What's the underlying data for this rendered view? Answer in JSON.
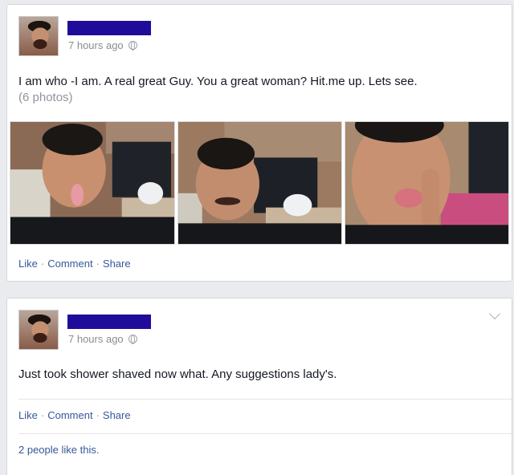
{
  "posts": [
    {
      "timestamp": "7 hours ago",
      "text": "I am who -I am. A real great Guy. You a great woman? Hit.me up. Lets see.",
      "photo_count": "(6 photos)",
      "actions": {
        "like": "Like",
        "comment": "Comment",
        "share": "Share",
        "separator": "·"
      }
    },
    {
      "timestamp": "7 hours ago",
      "text": "Just took shower shaved now what. Any suggestions lady's.",
      "actions": {
        "like": "Like",
        "comment": "Comment",
        "share": "Share",
        "separator": "·"
      },
      "likes_summary": "2 people like this."
    }
  ],
  "colors": {
    "redaction": "#1f0c9a",
    "link": "#365899",
    "background": "#e9ebee"
  },
  "icons": [
    "globe-icon",
    "chevron-down-icon"
  ]
}
